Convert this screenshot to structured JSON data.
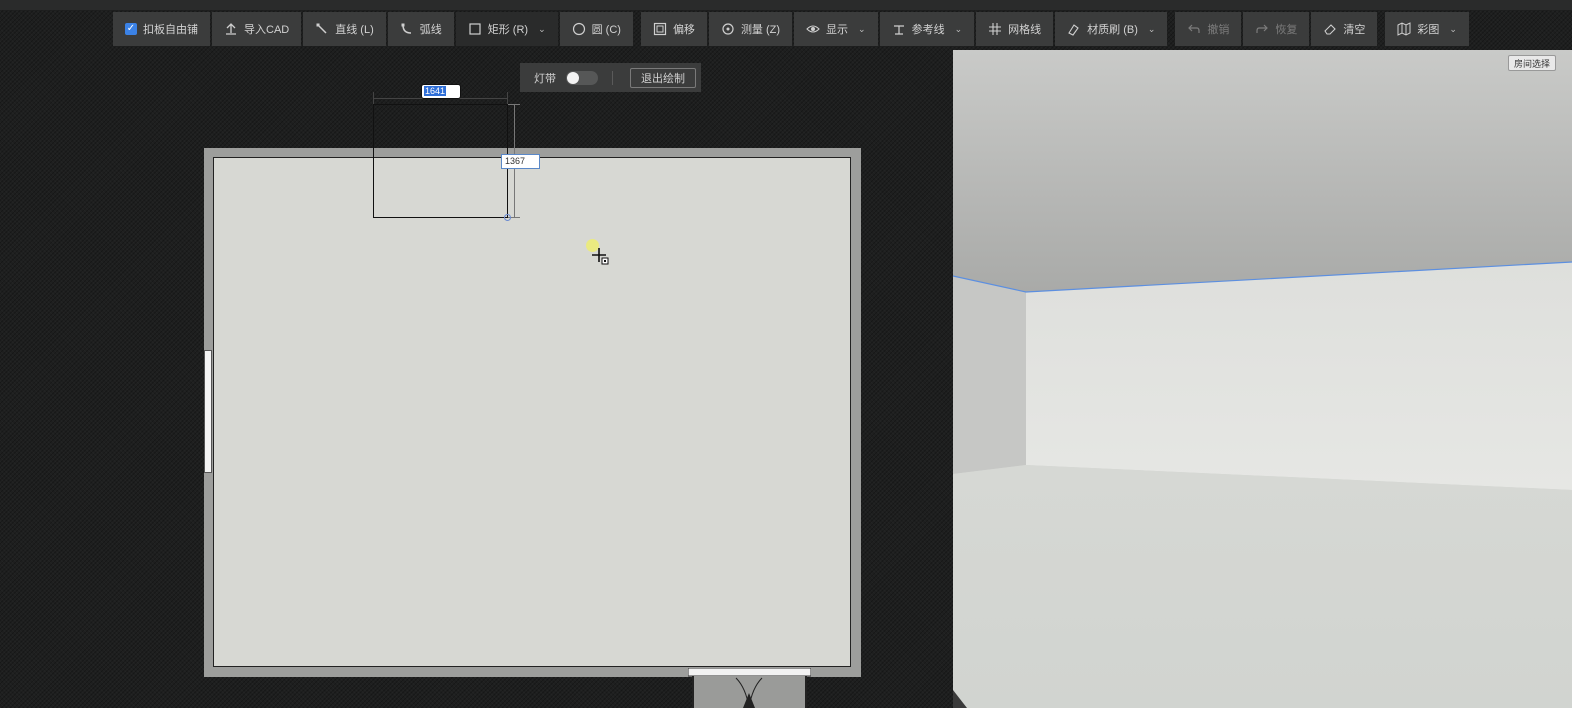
{
  "toolbar": {
    "items": [
      {
        "label": "扣板自由铺",
        "icon": "checkbox-checked-icon"
      },
      {
        "label": "导入CAD",
        "icon": "upload-icon"
      },
      {
        "label": "直线 (L)",
        "icon": "line-icon"
      },
      {
        "label": "弧线",
        "icon": "arc-icon"
      },
      {
        "label": "矩形 (R)",
        "icon": "rectangle-icon"
      },
      {
        "label": "圆 (C)",
        "icon": "circle-icon"
      },
      {
        "label": "偏移",
        "icon": "offset-icon"
      },
      {
        "label": "测量 (Z)",
        "icon": "measure-icon"
      },
      {
        "label": "显示",
        "icon": "eye-icon"
      },
      {
        "label": "参考线",
        "icon": "guide-line-icon"
      },
      {
        "label": "网格线",
        "icon": "grid-icon"
      },
      {
        "label": "材质刷 (B)",
        "icon": "brush-icon"
      },
      {
        "label": "撤销",
        "icon": "undo-icon"
      },
      {
        "label": "恢复",
        "icon": "redo-icon"
      },
      {
        "label": "清空",
        "icon": "eraser-icon"
      },
      {
        "label": "彩图",
        "icon": "map-icon"
      }
    ]
  },
  "subbar": {
    "light_strip_label": "灯带",
    "light_strip_on": false,
    "exit_label": "退出绘制"
  },
  "drawing": {
    "width_value": "1641",
    "height_value": "1367"
  },
  "view3d": {
    "room_select_label": "房间选择"
  },
  "colors": {
    "accent": "#3b82e6",
    "toolbar_bg": "#3b3c3c",
    "floor": "#d7d8d3",
    "wall": "#9d9e9c"
  }
}
